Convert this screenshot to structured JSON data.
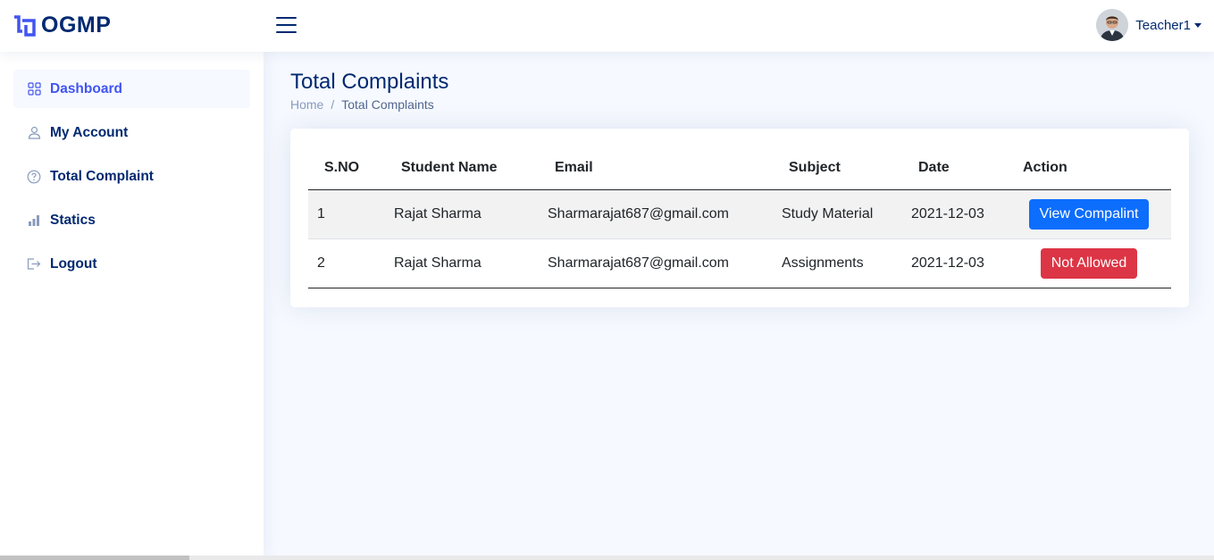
{
  "header": {
    "logo_text": "OGMP",
    "profile_name": "Teacher1"
  },
  "sidebar": {
    "items": [
      {
        "label": "Dashboard",
        "icon": "grid-icon"
      },
      {
        "label": "My Account",
        "icon": "person-icon"
      },
      {
        "label": "Total Complaint",
        "icon": "question-circle-icon"
      },
      {
        "label": "Statics",
        "icon": "bar-chart-icon"
      },
      {
        "label": "Logout",
        "icon": "logout-icon"
      }
    ]
  },
  "main": {
    "title": "Total Complaints",
    "breadcrumb": {
      "home": "Home",
      "separator": "/",
      "current": "Total Complaints"
    },
    "table": {
      "headers": [
        "S.NO",
        "Student Name",
        "Email",
        "Subject",
        "Date",
        "Action"
      ],
      "rows": [
        {
          "sno": "1",
          "name": "Rajat Sharma",
          "email": "Sharmarajat687@gmail.com",
          "subject": "Study Material",
          "date": "2021-12-03",
          "action": "View Compalint"
        },
        {
          "sno": "2",
          "name": "Rajat Sharma",
          "email": "Sharmarajat687@gmail.com",
          "subject": "Assignments",
          "date": "2021-12-03",
          "action": "Not Allowed"
        }
      ]
    }
  },
  "colors": {
    "brand": "#4154f1",
    "navy": "#012970",
    "primary_button": "#0d6efd",
    "danger_button": "#dc3545",
    "page_bg": "#f6f9ff"
  }
}
